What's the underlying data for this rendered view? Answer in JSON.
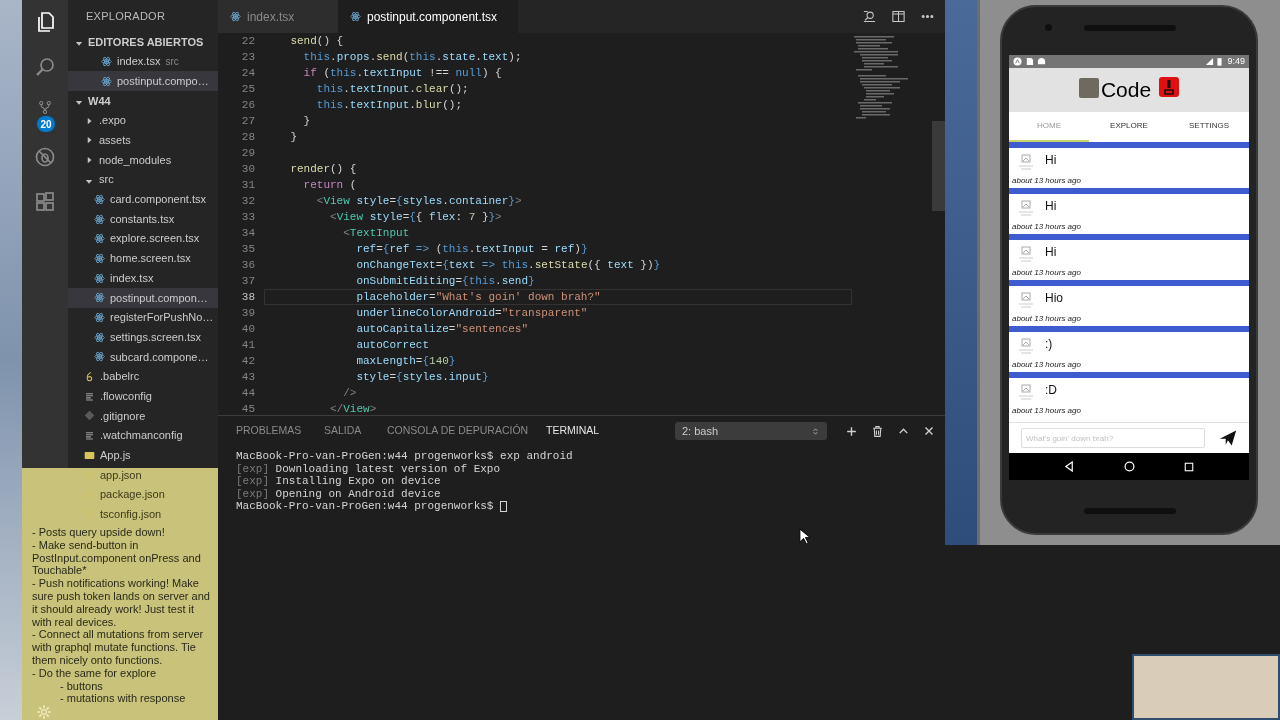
{
  "activity_bar": {
    "icons": [
      {
        "kind": "files",
        "selected": true
      },
      {
        "kind": "search",
        "selected": false
      },
      {
        "kind": "source-control",
        "selected": false,
        "badge": "20"
      },
      {
        "kind": "debug",
        "selected": false
      },
      {
        "kind": "extensions",
        "selected": false
      }
    ]
  },
  "sidebar": {
    "title": "EXPLORADOR",
    "sections": [
      {
        "title": "EDITORES ABIERTOS",
        "expanded": true,
        "items": [
          {
            "kind": "react",
            "label": "index.tsx",
            "description": "src",
            "selected": false
          },
          {
            "kind": "react",
            "label": "postinput.compo…",
            "selected": true
          }
        ]
      },
      {
        "title": "W44",
        "expanded": true,
        "items": [
          {
            "kind": "folder",
            "label": ".expo",
            "expanded": false,
            "selected": false
          },
          {
            "kind": "folder",
            "label": "assets",
            "expanded": false,
            "selected": false
          },
          {
            "kind": "folder",
            "label": "node_modules",
            "expanded": false,
            "selected": false
          },
          {
            "kind": "folder",
            "label": "src",
            "expanded": true,
            "selected": false,
            "children": [
              {
                "kind": "react",
                "label": "card.component.tsx",
                "selected": false
              },
              {
                "kind": "react",
                "label": "constants.tsx",
                "selected": false
              },
              {
                "kind": "react",
                "label": "explore.screen.tsx",
                "selected": false
              },
              {
                "kind": "react",
                "label": "home.screen.tsx",
                "selected": false
              },
              {
                "kind": "react",
                "label": "index.tsx",
                "selected": false
              },
              {
                "kind": "react",
                "label": "postinput.compon…",
                "selected": true
              },
              {
                "kind": "react",
                "label": "registerForPushNo…",
                "selected": false
              },
              {
                "kind": "react",
                "label": "settings.screen.tsx",
                "selected": false
              },
              {
                "kind": "react",
                "label": "subcard.compone…",
                "selected": false
              }
            ]
          },
          {
            "kind": "babel",
            "label": ".babelrc",
            "selected": false
          },
          {
            "kind": "config",
            "label": ".flowconfig",
            "selected": false
          },
          {
            "kind": "git",
            "label": ".gitignore",
            "selected": false
          },
          {
            "kind": "config",
            "label": ".watchmanconfig",
            "selected": false
          },
          {
            "kind": "js",
            "label": "App.js",
            "selected": false
          },
          {
            "kind": "json",
            "label": "app.json",
            "selected": false
          },
          {
            "kind": "json",
            "label": "package.json",
            "selected": false
          },
          {
            "kind": "json",
            "label": "tsconfig.json",
            "selected": false
          }
        ]
      }
    ]
  },
  "editor": {
    "tabs": [
      {
        "label": "index.tsx",
        "selected": false
      },
      {
        "label": "postinput.component.tsx",
        "selected": true
      }
    ],
    "lines": [
      {
        "number": "22",
        "current": false,
        "tokens": [
          {
            "kind": "fn",
            "text": "    send"
          },
          {
            "kind": "plain",
            "text": "() {"
          }
        ]
      },
      {
        "number": "23",
        "current": false,
        "tokens": [
          {
            "kind": "kw",
            "text": "      this"
          },
          {
            "kind": "plain",
            "text": "."
          },
          {
            "kind": "var",
            "text": "props"
          },
          {
            "kind": "plain",
            "text": "."
          },
          {
            "kind": "fn",
            "text": "send"
          },
          {
            "kind": "plain",
            "text": "("
          },
          {
            "kind": "kw",
            "text": "this"
          },
          {
            "kind": "plain",
            "text": "."
          },
          {
            "kind": "var",
            "text": "state"
          },
          {
            "kind": "plain",
            "text": "."
          },
          {
            "kind": "var",
            "text": "text"
          },
          {
            "kind": "plain",
            "text": ");"
          }
        ]
      },
      {
        "number": "24",
        "current": false,
        "tokens": [
          {
            "kind": "ctl",
            "text": "      if"
          },
          {
            "kind": "plain",
            "text": " ("
          },
          {
            "kind": "kw",
            "text": "this"
          },
          {
            "kind": "plain",
            "text": "."
          },
          {
            "kind": "var",
            "text": "textInput"
          },
          {
            "kind": "plain",
            "text": " !== "
          },
          {
            "kind": "kw",
            "text": "null"
          },
          {
            "kind": "plain",
            "text": ") {"
          }
        ]
      },
      {
        "number": "25",
        "current": false,
        "tokens": [
          {
            "kind": "kw",
            "text": "        this"
          },
          {
            "kind": "plain",
            "text": "."
          },
          {
            "kind": "var",
            "text": "textInput"
          },
          {
            "kind": "plain",
            "text": "."
          },
          {
            "kind": "fn",
            "text": "clear"
          },
          {
            "kind": "plain",
            "text": "();"
          }
        ]
      },
      {
        "number": "26",
        "current": false,
        "tokens": [
          {
            "kind": "kw",
            "text": "        this"
          },
          {
            "kind": "plain",
            "text": "."
          },
          {
            "kind": "var",
            "text": "textInput"
          },
          {
            "kind": "plain",
            "text": "."
          },
          {
            "kind": "fn",
            "text": "blur"
          },
          {
            "kind": "plain",
            "text": "();"
          }
        ]
      },
      {
        "number": "27",
        "current": false,
        "tokens": [
          {
            "kind": "plain",
            "text": "      }"
          }
        ]
      },
      {
        "number": "28",
        "current": false,
        "tokens": [
          {
            "kind": "plain",
            "text": "    }"
          }
        ]
      },
      {
        "number": "29",
        "current": false
      },
      {
        "number": "30",
        "current": false,
        "tokens": [
          {
            "kind": "fn",
            "text": "    render"
          },
          {
            "kind": "plain",
            "text": "() {"
          }
        ]
      },
      {
        "number": "31",
        "current": false,
        "tokens": [
          {
            "kind": "ctl",
            "text": "      return"
          },
          {
            "kind": "plain",
            "text": " ("
          }
        ]
      },
      {
        "number": "32",
        "current": false,
        "tokens": [
          {
            "kind": "punct",
            "text": "        <"
          },
          {
            "kind": "tag",
            "text": "View"
          },
          {
            "kind": "var",
            "text": " style"
          },
          {
            "kind": "plain",
            "text": "="
          },
          {
            "kind": "brace",
            "text": "{"
          },
          {
            "kind": "var",
            "text": "styles"
          },
          {
            "kind": "plain",
            "text": "."
          },
          {
            "kind": "var",
            "text": "container"
          },
          {
            "kind": "brace",
            "text": "}"
          },
          {
            "kind": "punct",
            "text": ">"
          }
        ]
      },
      {
        "number": "33",
        "current": false,
        "tokens": [
          {
            "kind": "punct",
            "text": "          <"
          },
          {
            "kind": "tag",
            "text": "View"
          },
          {
            "kind": "var",
            "text": " style"
          },
          {
            "kind": "plain",
            "text": "="
          },
          {
            "kind": "brace",
            "text": "{"
          },
          {
            "kind": "plain",
            "text": "{ "
          },
          {
            "kind": "var",
            "text": "flex"
          },
          {
            "kind": "plain",
            "text": ": "
          },
          {
            "kind": "num",
            "text": "7"
          },
          {
            "kind": "plain",
            "text": " }"
          },
          {
            "kind": "brace",
            "text": "}"
          },
          {
            "kind": "punct",
            "text": ">"
          }
        ]
      },
      {
        "number": "34",
        "current": false,
        "tokens": [
          {
            "kind": "punct",
            "text": "            <"
          },
          {
            "kind": "tag",
            "text": "TextInput"
          }
        ]
      },
      {
        "number": "35",
        "current": false,
        "tokens": [
          {
            "kind": "var",
            "text": "              ref"
          },
          {
            "kind": "plain",
            "text": "="
          },
          {
            "kind": "brace",
            "text": "{"
          },
          {
            "kind": "var",
            "text": "ref"
          },
          {
            "kind": "kw",
            "text": " =>"
          },
          {
            "kind": "plain",
            "text": " ("
          },
          {
            "kind": "kw",
            "text": "this"
          },
          {
            "kind": "plain",
            "text": "."
          },
          {
            "kind": "var",
            "text": "textInput"
          },
          {
            "kind": "plain",
            "text": " = "
          },
          {
            "kind": "var",
            "text": "ref"
          },
          {
            "kind": "plain",
            "text": ")"
          },
          {
            "kind": "brace",
            "text": "}"
          }
        ]
      },
      {
        "number": "36",
        "current": false,
        "tokens": [
          {
            "kind": "var",
            "text": "              onChangeText"
          },
          {
            "kind": "plain",
            "text": "="
          },
          {
            "kind": "brace",
            "text": "{"
          },
          {
            "kind": "var",
            "text": "text"
          },
          {
            "kind": "kw",
            "text": " =>"
          },
          {
            "kind": "kw",
            "text": " this"
          },
          {
            "kind": "plain",
            "text": "."
          },
          {
            "kind": "fn",
            "text": "setState"
          },
          {
            "kind": "plain",
            "text": "({ "
          },
          {
            "kind": "var",
            "text": "text"
          },
          {
            "kind": "plain",
            "text": " })"
          },
          {
            "kind": "brace",
            "text": "}"
          }
        ]
      },
      {
        "number": "37",
        "current": false,
        "tokens": [
          {
            "kind": "var",
            "text": "              onSubmitEditing"
          },
          {
            "kind": "plain",
            "text": "="
          },
          {
            "kind": "brace",
            "text": "{"
          },
          {
            "kind": "kw",
            "text": "this"
          },
          {
            "kind": "plain",
            "text": "."
          },
          {
            "kind": "var",
            "text": "send"
          },
          {
            "kind": "brace",
            "text": "}"
          }
        ]
      },
      {
        "number": "38",
        "current": true,
        "tokens": [
          {
            "kind": "var",
            "text": "              placeholder"
          },
          {
            "kind": "plain",
            "text": "="
          },
          {
            "kind": "str",
            "text": "\"What's goin' down brah?\""
          }
        ]
      },
      {
        "number": "39",
        "current": false,
        "tokens": [
          {
            "kind": "var",
            "text": "              underlineColorAndroid"
          },
          {
            "kind": "plain",
            "text": "="
          },
          {
            "kind": "str",
            "text": "\"transparent\""
          }
        ]
      },
      {
        "number": "40",
        "current": false,
        "tokens": [
          {
            "kind": "var",
            "text": "              autoCapitalize"
          },
          {
            "kind": "plain",
            "text": "="
          },
          {
            "kind": "str",
            "text": "\"sentences\""
          }
        ]
      },
      {
        "number": "41",
        "current": false,
        "tokens": [
          {
            "kind": "var",
            "text": "              autoCorrect"
          }
        ]
      },
      {
        "number": "42",
        "current": false,
        "tokens": [
          {
            "kind": "var",
            "text": "              maxLength"
          },
          {
            "kind": "plain",
            "text": "="
          },
          {
            "kind": "brace",
            "text": "{"
          },
          {
            "kind": "num",
            "text": "140"
          },
          {
            "kind": "brace",
            "text": "}"
          }
        ]
      },
      {
        "number": "43",
        "current": false,
        "tokens": [
          {
            "kind": "var",
            "text": "              style"
          },
          {
            "kind": "plain",
            "text": "="
          },
          {
            "kind": "brace",
            "text": "{"
          },
          {
            "kind": "var",
            "text": "styles"
          },
          {
            "kind": "plain",
            "text": "."
          },
          {
            "kind": "var",
            "text": "input"
          },
          {
            "kind": "brace",
            "text": "}"
          }
        ]
      },
      {
        "number": "44",
        "current": false,
        "tokens": [
          {
            "kind": "punct",
            "text": "            />"
          }
        ]
      },
      {
        "number": "45",
        "current": false,
        "tokens": [
          {
            "kind": "punct",
            "text": "          </"
          },
          {
            "kind": "tag",
            "text": "View"
          },
          {
            "kind": "punct",
            "text": ">"
          }
        ]
      }
    ]
  },
  "panel": {
    "tabs": [
      {
        "label": "PROBLEMAS",
        "selected": false
      },
      {
        "label": "SALIDA",
        "selected": false
      },
      {
        "label": "CONSOLA DE DEPURACIÓN",
        "selected": false
      },
      {
        "label": "TERMINAL",
        "selected": true
      }
    ],
    "terminal_select": "2: bash",
    "terminal": [
      {
        "kind": "prompt",
        "text": "MacBook-Pro-van-ProGen:w44 progenworks$ exp android",
        "cursor": false
      },
      {
        "kind": "log",
        "prefix": "[exp]",
        "text": "Downloading latest version of Expo",
        "cursor": false
      },
      {
        "kind": "log",
        "prefix": "[exp]",
        "text": "Installing Expo on device",
        "cursor": false
      },
      {
        "kind": "log",
        "prefix": "[exp]",
        "text": "Opening on Android device",
        "cursor": false
      },
      {
        "kind": "prompt",
        "text": "MacBook-Pro-van-ProGen:w44 progenworks$",
        "cursor": true
      }
    ]
  },
  "sticky_note": {
    "items": [
      {
        "text": "- Posts query upside down!"
      },
      {
        "text": "- Make send-button in PostInput.component onPress and Touchable*"
      },
      {
        "text": "- Push notifications working! Make sure push token lands on server and it should already work! Just test it with real devices."
      },
      {
        "text": "- Connect all mutations from server with graphql mutate functions. Tie them nicely onto functions."
      },
      {
        "text": "- Do the same for explore",
        "children": [
          {
            "text": "- buttons"
          },
          {
            "text": "- mutations with response"
          }
        ]
      }
    ]
  },
  "phone": {
    "status_bar": {
      "time": "9:49"
    },
    "app_title": "Code",
    "tabs": [
      {
        "label": "HOME",
        "selected": true
      },
      {
        "label": "EXPLORE",
        "selected": false
      },
      {
        "label": "SETTINGS",
        "selected": false
      }
    ],
    "posts": [
      {
        "text": "Hi",
        "time": "about 13 hours ago"
      },
      {
        "text": "Hi",
        "time": "about 13 hours ago"
      },
      {
        "text": "Hi",
        "time": "about 13 hours ago"
      },
      {
        "text": "Hio",
        "time": "about 13 hours ago"
      },
      {
        "text": ":)",
        "time": "about 13 hours ago"
      },
      {
        "text": ":D",
        "time": "about 13 hours ago"
      }
    ],
    "input": {
      "placeholder": "What's goin' down brah?"
    }
  }
}
